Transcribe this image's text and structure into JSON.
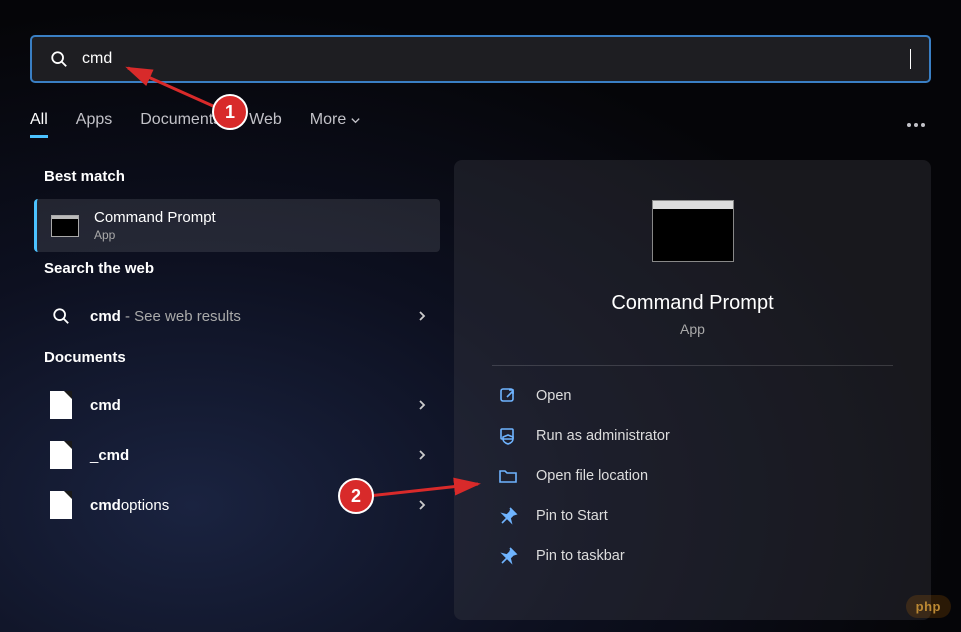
{
  "search": {
    "value": "cmd"
  },
  "tabs": {
    "all": "All",
    "apps": "Apps",
    "documents": "Documents",
    "web": "Web",
    "more": "More"
  },
  "sections": {
    "bestMatch": "Best match",
    "searchWeb": "Search the web",
    "documents": "Documents"
  },
  "bestMatch": {
    "name": "Command Prompt",
    "type": "App"
  },
  "webResult": {
    "boldTerm": "cmd",
    "suffix": " - See web results"
  },
  "docs": [
    {
      "bold": "cmd",
      "rest": ""
    },
    {
      "bold": "",
      "rest": "",
      "prefix": "_",
      "name": "cmd"
    },
    {
      "bold": "cmd",
      "rest": "options"
    }
  ],
  "doc0": {
    "bold": "cmd",
    "rest": ""
  },
  "doc1": {
    "prefix": "_",
    "bold": "cmd",
    "rest": ""
  },
  "doc2": {
    "bold": "cmd",
    "rest": "options"
  },
  "detail": {
    "name": "Command Prompt",
    "type": "App"
  },
  "actions": {
    "open": "Open",
    "runAdmin": "Run as administrator",
    "openLocation": "Open file location",
    "pinStart": "Pin to Start",
    "pinTaskbar": "Pin to taskbar"
  },
  "annotations": {
    "step1": "1",
    "step2": "2"
  },
  "watermark": "php"
}
